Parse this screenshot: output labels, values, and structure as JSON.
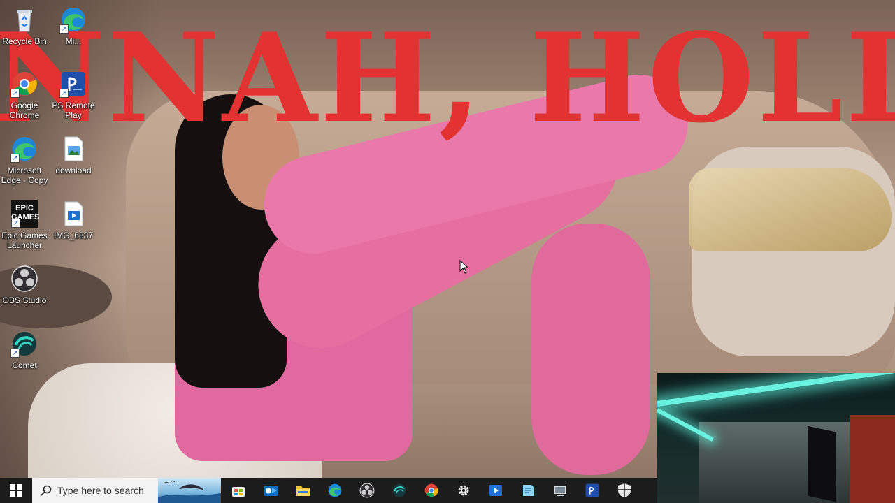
{
  "wallpaper": {
    "headline": "NNAH, HOLLY"
  },
  "desktop_icons": [
    {
      "id": "recycle-bin",
      "label": "Recycle Bin",
      "icon": "recycle-bin-icon"
    },
    {
      "id": "microsoft-edge",
      "label": "Mi...",
      "icon": "edge-icon"
    },
    {
      "id": "google-chrome",
      "label": "Google Chrome",
      "icon": "chrome-icon"
    },
    {
      "id": "ps-remote-play",
      "label": "PS Remote Play",
      "icon": "ps-remote-play-icon"
    },
    {
      "id": "edge-copy",
      "label": "Microsoft Edge - Copy",
      "icon": "edge-icon"
    },
    {
      "id": "download",
      "label": "download",
      "icon": "image-file-icon"
    },
    {
      "id": "epic-games",
      "label": "Epic Games Launcher",
      "icon": "epic-games-icon",
      "badge": "EPIC GAMES"
    },
    {
      "id": "img-6837",
      "label": "IMG_6837",
      "icon": "video-file-icon"
    },
    {
      "id": "obs-studio",
      "label": "OBS Studio",
      "icon": "obs-icon"
    },
    {
      "id": "comet",
      "label": "Comet",
      "icon": "comet-icon"
    }
  ],
  "taskbar": {
    "search_placeholder": "Type here to search",
    "apps": [
      {
        "name": "widgets",
        "icon": "store-icon"
      },
      {
        "name": "outlook",
        "icon": "mail-icon"
      },
      {
        "name": "file-explorer",
        "icon": "folder-icon"
      },
      {
        "name": "edge",
        "icon": "edge-icon"
      },
      {
        "name": "obs-studio",
        "icon": "obs-icon"
      },
      {
        "name": "comet",
        "icon": "comet-icon"
      },
      {
        "name": "chrome",
        "icon": "chrome-icon"
      },
      {
        "name": "settings",
        "icon": "gear-icon"
      },
      {
        "name": "media-player",
        "icon": "play-icon"
      },
      {
        "name": "notepad",
        "icon": "notepad-icon"
      },
      {
        "name": "computer",
        "icon": "computer-icon"
      },
      {
        "name": "ps-remote-play",
        "icon": "ps-remote-play-icon"
      },
      {
        "name": "security",
        "icon": "shield-icon"
      }
    ]
  },
  "colors": {
    "headline": "#e23232",
    "taskbar": "#1c1c1c",
    "accent": "#2b7de9",
    "webcam_led": "#6af2e0"
  }
}
